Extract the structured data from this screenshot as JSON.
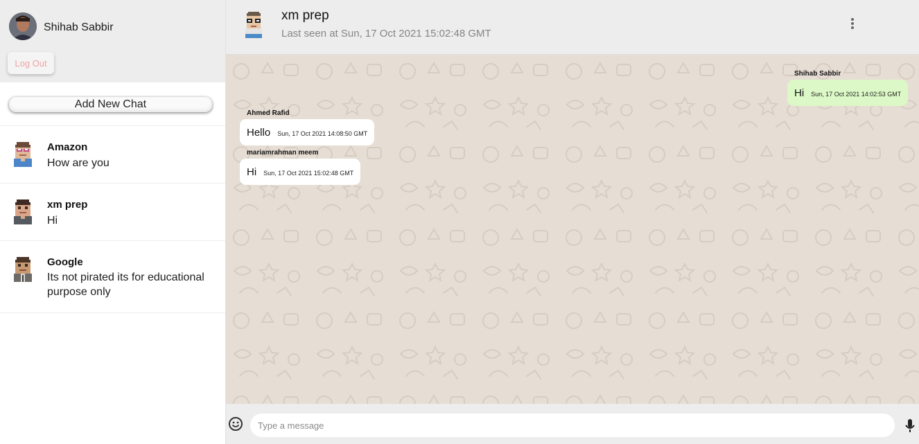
{
  "user": {
    "name": "Shihab Sabbir",
    "logout_label": "Log Out"
  },
  "sidebar": {
    "add_chat_label": "Add New Chat",
    "chats": [
      {
        "name": "Amazon",
        "last_message": "How are you",
        "avatar_icon": "pixel-avatar-glasses-icon"
      },
      {
        "name": "xm prep",
        "last_message": "Hi",
        "avatar_icon": "pixel-avatar-icon"
      },
      {
        "name": "Google",
        "last_message": "Its not pirated its for educational purpose only",
        "avatar_icon": "pixel-avatar-tie-icon"
      }
    ]
  },
  "chat_header": {
    "name": "xm prep",
    "last_seen": "Last seen at Sun, 17 Oct 2021 15:02:48 GMT",
    "menu_icon": "more-vertical-icon"
  },
  "messages": [
    {
      "sender": "Shihab Sabbir",
      "text": "Hi",
      "timestamp": "Sun, 17 Oct 2021 14:02:53 GMT",
      "own": true
    },
    {
      "sender": "Ahmed Rafid",
      "text": "Hello",
      "timestamp": "Sun, 17 Oct 2021 14:08:50 GMT",
      "own": false
    },
    {
      "sender": "mariamrahman meem",
      "text": "Hi",
      "timestamp": "Sun, 17 Oct 2021 15:02:48 GMT",
      "own": false
    }
  ],
  "input": {
    "placeholder": "Type a message",
    "emoji_icon": "emoji-icon",
    "mic_icon": "mic-icon"
  },
  "colors": {
    "header_bg": "#ededed",
    "chat_bg": "#e6ddd4",
    "own_bubble": "#dcf8c6",
    "other_bubble": "#ffffff",
    "logout_text": "#f0a2a2"
  }
}
